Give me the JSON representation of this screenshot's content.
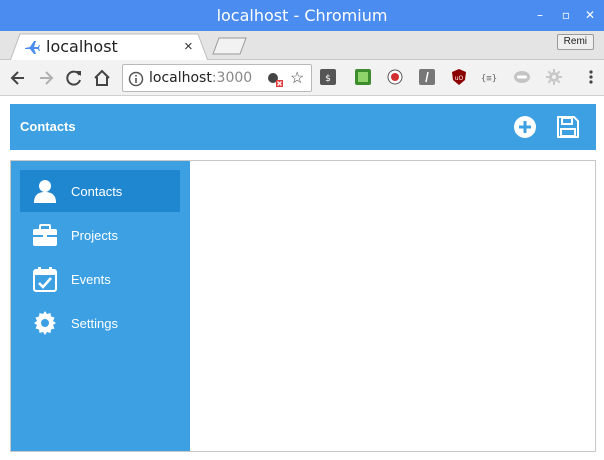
{
  "window": {
    "title": "localhost - Chromium",
    "minimize_glyph": "–",
    "maximize_glyph": "▫",
    "close_glyph": "✕"
  },
  "tabs": [
    {
      "title": "localhost",
      "close_glyph": "×",
      "favicon": "airplane-icon"
    }
  ],
  "profile": {
    "name": "Remi"
  },
  "toolbar": {
    "url_host": "localhost",
    "url_port": ":3000",
    "star_glyph": "☆",
    "extensions": [
      "money-extension-icon",
      "image-extension-icon",
      "record-extension-icon",
      "script-extension-icon",
      "ublock-extension-icon",
      "json-extension-icon",
      "toggle-extension-icon",
      "settings-extension-icon"
    ]
  },
  "app": {
    "header": {
      "title": "Contacts",
      "add_icon": "add-circle-icon",
      "save_icon": "save-icon"
    },
    "nav": [
      {
        "label": "Contacts",
        "icon": "user-icon",
        "active": true
      },
      {
        "label": "Projects",
        "icon": "briefcase-icon",
        "active": false
      },
      {
        "label": "Events",
        "icon": "calendar-check-icon",
        "active": false
      },
      {
        "label": "Settings",
        "icon": "gear-icon",
        "active": false
      }
    ]
  },
  "colors": {
    "titlebar": "#4a8cf0",
    "app_accent": "#3ca0e3",
    "nav_active": "#1f87d0"
  }
}
